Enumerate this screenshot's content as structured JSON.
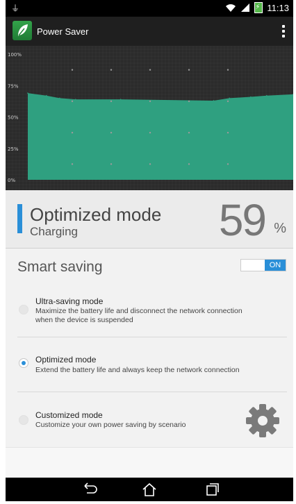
{
  "status_bar": {
    "time": "11:13",
    "icons": [
      "usb-icon",
      "wifi-icon",
      "signal-icon",
      "battery-charging-icon"
    ]
  },
  "app_bar": {
    "title": "Power Saver",
    "icon": "leaf-app-icon",
    "menu_icon": "more-vert-icon"
  },
  "chart_data": {
    "type": "area",
    "ylabels": [
      "100%",
      "75%",
      "50%",
      "25%",
      "0%"
    ],
    "ylim": [
      0,
      100
    ],
    "x": [
      0,
      0.07,
      0.12,
      0.18,
      0.35,
      0.7,
      0.76,
      0.84,
      0.9,
      1.0
    ],
    "values": [
      69,
      67,
      65,
      64,
      64,
      63,
      65,
      66,
      67,
      68
    ],
    "colors": {
      "fill": "#2fa080",
      "line": "#2fa080",
      "background": "#2b2b2b",
      "grid": "#3a3a3a"
    },
    "grid": true
  },
  "mode": {
    "title": "Optimized mode",
    "status": "Charging",
    "percent": "59",
    "percent_sign": "%",
    "accent": "#2a8fd8"
  },
  "smart_saving": {
    "label": "Smart saving",
    "toggle_label": "ON",
    "enabled": true
  },
  "options": [
    {
      "title": "Ultra-saving mode",
      "desc": "Maximize the battery life and disconnect the network connection when the device is suspended",
      "selected": false
    },
    {
      "title": "Optimized mode",
      "desc": "Extend the battery life and always keep the network connection",
      "selected": true
    },
    {
      "title": "Customized mode",
      "desc": "Customize your own power saving by scenario",
      "selected": false,
      "icon": "gear-icon"
    }
  ],
  "nav_bar": {
    "buttons": [
      "back-icon",
      "home-icon",
      "recents-icon"
    ]
  }
}
